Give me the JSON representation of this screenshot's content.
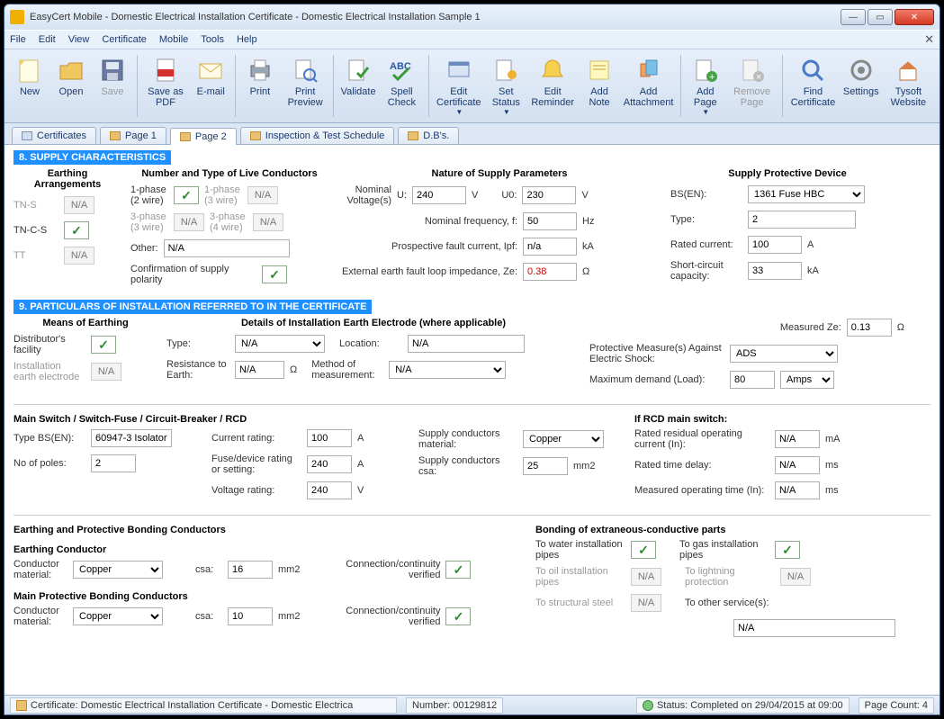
{
  "title": "EasyCert Mobile - Domestic Electrical Installation Certificate - Domestic Electrical Installation Sample 1",
  "menu": {
    "file": "File",
    "edit": "Edit",
    "view": "View",
    "cert": "Certificate",
    "mobile": "Mobile",
    "tools": "Tools",
    "help": "Help"
  },
  "ribbon": {
    "new": "New",
    "open": "Open",
    "save": "Save",
    "saveas": "Save as PDF",
    "email": "E-mail",
    "print": "Print",
    "preview": "Print Preview",
    "validate": "Validate",
    "spell": "Spell Check",
    "editcert": "Edit Certificate",
    "setstatus": "Set Status",
    "editrem": "Edit Reminder",
    "addnote": "Add Note",
    "addatt": "Add Attachment",
    "addpage": "Add Page",
    "rempage": "Remove Page",
    "findcert": "Find Certificate",
    "settings": "Settings",
    "website": "Tysoft Website"
  },
  "tabs": {
    "certs": "Certificates",
    "p1": "Page 1",
    "p2": "Page 2",
    "its": "Inspection & Test Schedule",
    "dbs": "D.B's."
  },
  "s8": {
    "bar": "8.  SUPPLY CHARACTERISTICS",
    "earthhead": "Earthing Arrangements",
    "tns": "TN-S",
    "tncs": "TN-C-S",
    "tt": "TT",
    "na": "N/A",
    "livehead": "Number and Type of Live Conductors",
    "p12": "1-phase (2 wire)",
    "p13": "1-phase (3 wire)",
    "p33": "3-phase (3 wire)",
    "p34": "3-phase (4 wire)",
    "other": "Other:",
    "otherval": "N/A",
    "conf": "Confirmation of supply polarity",
    "nathead": "Nature of Supply Parameters",
    "nv": "Nominal Voltage(s)",
    "u": "U:",
    "uval": "240",
    "v": "V",
    "u0": "U0:",
    "u0val": "230",
    "nf": "Nominal frequency, f:",
    "nfval": "50",
    "hz": "Hz",
    "pfc": "Prospective fault current, Ipf:",
    "pfcval": "n/a",
    "ka": "kA",
    "ze": "External earth fault loop impedance, Ze:",
    "zeval": "0.38",
    "ohm": "Ω",
    "spdhead": "Supply Protective Device",
    "bsen": "BS(EN):",
    "bsenval": "1361 Fuse HBC",
    "type": "Type:",
    "typeval": "2",
    "rated": "Rated current:",
    "ratedval": "100",
    "a": "A",
    "sc": "Short-circuit capacity:",
    "scval": "33"
  },
  "s9": {
    "bar": "9.  PARTICULARS OF INSTALLATION REFERRED TO IN THE CERTIFICATE",
    "moehead": "Means of Earthing",
    "dist": "Distributor's facility",
    "iee": "Installation earth electrode",
    "diehead": "Details of Installation Earth Electrode (where applicable)",
    "type": "Type:",
    "typeval": "N/A",
    "loc": "Location:",
    "locval": "N/A",
    "r2e": "Resistance to Earth:",
    "r2eval": "N/A",
    "ohm": "Ω",
    "mom": "Method of measurement:",
    "momval": "N/A",
    "mze": "Measured Ze:",
    "mzeval": "0.13",
    "pm": "Protective Measure(s) Against Electric Shock:",
    "pmval": "ADS",
    "mdl": "Maximum demand (Load):",
    "mdlval": "80",
    "amps": "Amps",
    "mshead": "Main Switch / Switch-Fuse / Circuit-Breaker / RCD",
    "tbs": "Type BS(EN):",
    "tbsval": "60947-3 Isolator",
    "nop": "No of poles:",
    "nopval": "2",
    "cr": "Current rating:",
    "crval": "100",
    "a": "A",
    "fdr": "Fuse/device rating or setting:",
    "fdrval": "240",
    "vr": "Voltage rating:",
    "vrval": "240",
    "v": "V",
    "scm": "Supply conductors material:",
    "scmval": "Copper",
    "scc": "Supply conductors csa:",
    "sccval": "25",
    "mm2": "mm2",
    "rcdhead": "If RCD main switch:",
    "rroc": "Rated residual operating current (In):",
    "rrocval": "N/A",
    "ma": "mA",
    "rtd": "Rated time delay:",
    "rtdval": "N/A",
    "ms": "ms",
    "mot": "Measured operating time (In):",
    "motval": "N/A",
    "epbchead": "Earthing and Protective Bonding Conductors",
    "echead": "Earthing Conductor",
    "cm": "Conductor material:",
    "csa": "csa:",
    "csaval1": "16",
    "csaval2": "10",
    "ccv": "Connection/continuity verified",
    "mpbchead": "Main Protective Bonding Conductors",
    "bechead": "Bonding of extraneous-conductive parts",
    "wip": "To water installation pipes",
    "gip": "To gas installation pipes",
    "oip": "To oil installation pipes",
    "lp": "To lightning protection",
    "ss": "To structural steel",
    "tos": "To other service(s):",
    "tosval": "N/A",
    "copper": "Copper",
    "na": "N/A"
  },
  "status": {
    "cert": "Certificate: Domestic Electrical Installation Certificate - Domestic Electrica",
    "num": "Number: 00129812",
    "stat": "Status: Completed on 29/04/2015 at 09:00",
    "pc": "Page Count: 4"
  }
}
